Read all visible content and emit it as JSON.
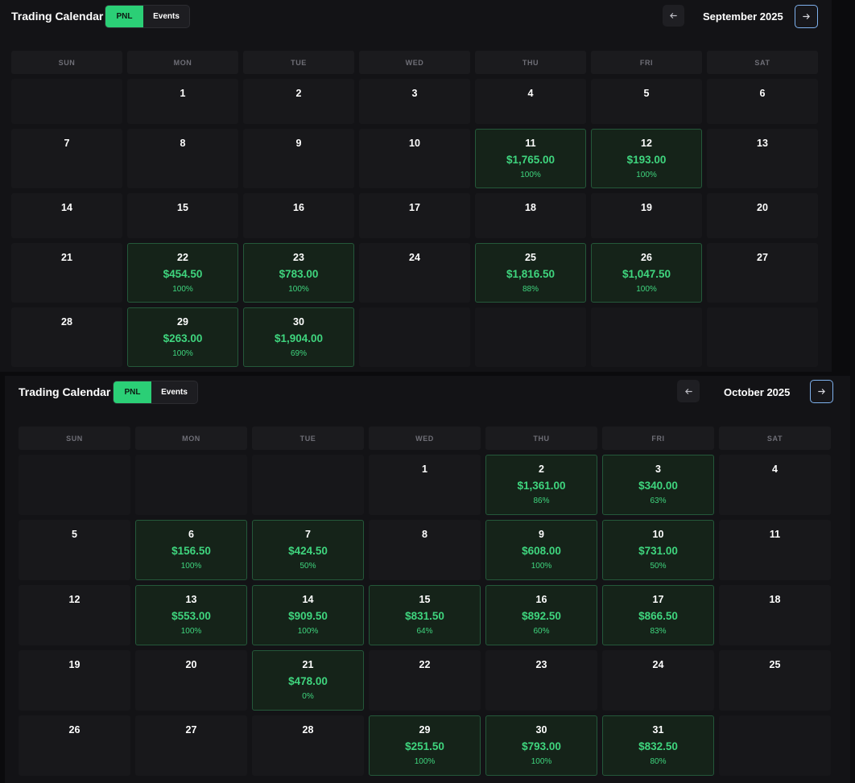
{
  "app_title": "Trading Calendar",
  "toggle": {
    "pnl_label": "PNL",
    "events_label": "Events",
    "active": "PNL"
  },
  "weekdays": [
    "SUN",
    "MON",
    "TUE",
    "WED",
    "THU",
    "FRI",
    "SAT"
  ],
  "colors": {
    "accent": "#2bcf76",
    "profit_text": "#3fd57e",
    "profit_bg": "#152319",
    "nav_focus": "#7fb2ee"
  },
  "icons": {
    "prev": "arrow-left-icon",
    "next": "arrow-right-icon"
  },
  "months": [
    {
      "label": "September 2025",
      "first_weekday": 1,
      "days_in_month": 30,
      "trading_days": {
        "11": {
          "pnl": "$1,765.00",
          "rate": "100%"
        },
        "12": {
          "pnl": "$193.00",
          "rate": "100%"
        },
        "22": {
          "pnl": "$454.50",
          "rate": "100%"
        },
        "23": {
          "pnl": "$783.00",
          "rate": "100%"
        },
        "25": {
          "pnl": "$1,816.50",
          "rate": "88%"
        },
        "26": {
          "pnl": "$1,047.50",
          "rate": "100%"
        },
        "29": {
          "pnl": "$263.00",
          "rate": "100%"
        },
        "30": {
          "pnl": "$1,904.00",
          "rate": "69%"
        }
      }
    },
    {
      "label": "October 2025",
      "first_weekday": 3,
      "days_in_month": 31,
      "trading_days": {
        "2": {
          "pnl": "$1,361.00",
          "rate": "86%"
        },
        "3": {
          "pnl": "$340.00",
          "rate": "63%"
        },
        "6": {
          "pnl": "$156.50",
          "rate": "100%"
        },
        "7": {
          "pnl": "$424.50",
          "rate": "50%"
        },
        "9": {
          "pnl": "$608.00",
          "rate": "100%"
        },
        "10": {
          "pnl": "$731.00",
          "rate": "50%"
        },
        "13": {
          "pnl": "$553.00",
          "rate": "100%"
        },
        "14": {
          "pnl": "$909.50",
          "rate": "100%"
        },
        "15": {
          "pnl": "$831.50",
          "rate": "64%"
        },
        "16": {
          "pnl": "$892.50",
          "rate": "60%"
        },
        "17": {
          "pnl": "$866.50",
          "rate": "83%"
        },
        "21": {
          "pnl": "$478.00",
          "rate": "0%"
        },
        "29": {
          "pnl": "$251.50",
          "rate": "100%"
        },
        "30": {
          "pnl": "$793.00",
          "rate": "100%"
        },
        "31": {
          "pnl": "$832.50",
          "rate": "80%"
        }
      }
    }
  ]
}
